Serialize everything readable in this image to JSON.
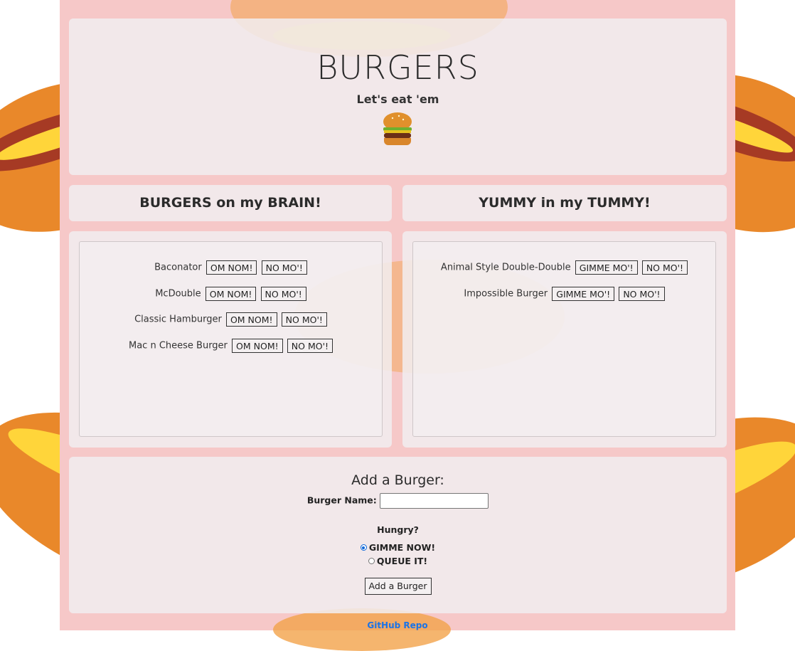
{
  "header": {
    "title": "BURGERS",
    "subtitle": "Let's eat 'em",
    "icon": "burger-emoji-icon"
  },
  "columns": {
    "left_heading": "BURGERS on my BRAIN!",
    "right_heading": "YUMMY in my TUMMY!"
  },
  "brain_list": [
    {
      "name": "Baconator",
      "primary": "OM NOM!",
      "secondary": "NO MO'!"
    },
    {
      "name": "McDouble",
      "primary": "OM NOM!",
      "secondary": "NO MO'!"
    },
    {
      "name": "Classic Hamburger",
      "primary": "OM NOM!",
      "secondary": "NO MO'!"
    },
    {
      "name": "Mac n Cheese Burger",
      "primary": "OM NOM!",
      "secondary": "NO MO'!"
    }
  ],
  "tummy_list": [
    {
      "name": "Animal Style Double-Double",
      "primary": "GIMME MO'!",
      "secondary": "NO MO'!"
    },
    {
      "name": "Impossible Burger",
      "primary": "GIMME MO'!",
      "secondary": "NO MO'!"
    }
  ],
  "form": {
    "title": "Add a Burger:",
    "name_label": "Burger Name:",
    "name_value": "",
    "hungry_label": "Hungry?",
    "options": [
      {
        "label": "GIMME NOW!",
        "checked": true
      },
      {
        "label": "QUEUE IT!",
        "checked": false
      }
    ],
    "submit_label": "Add a Burger"
  },
  "footer": {
    "link_text": "GitHub Repo"
  },
  "colors": {
    "page_column": "#f6c8c8",
    "panel": "#f1eef0",
    "link": "#1a73e8",
    "radio_accent": "#0b66d8"
  }
}
